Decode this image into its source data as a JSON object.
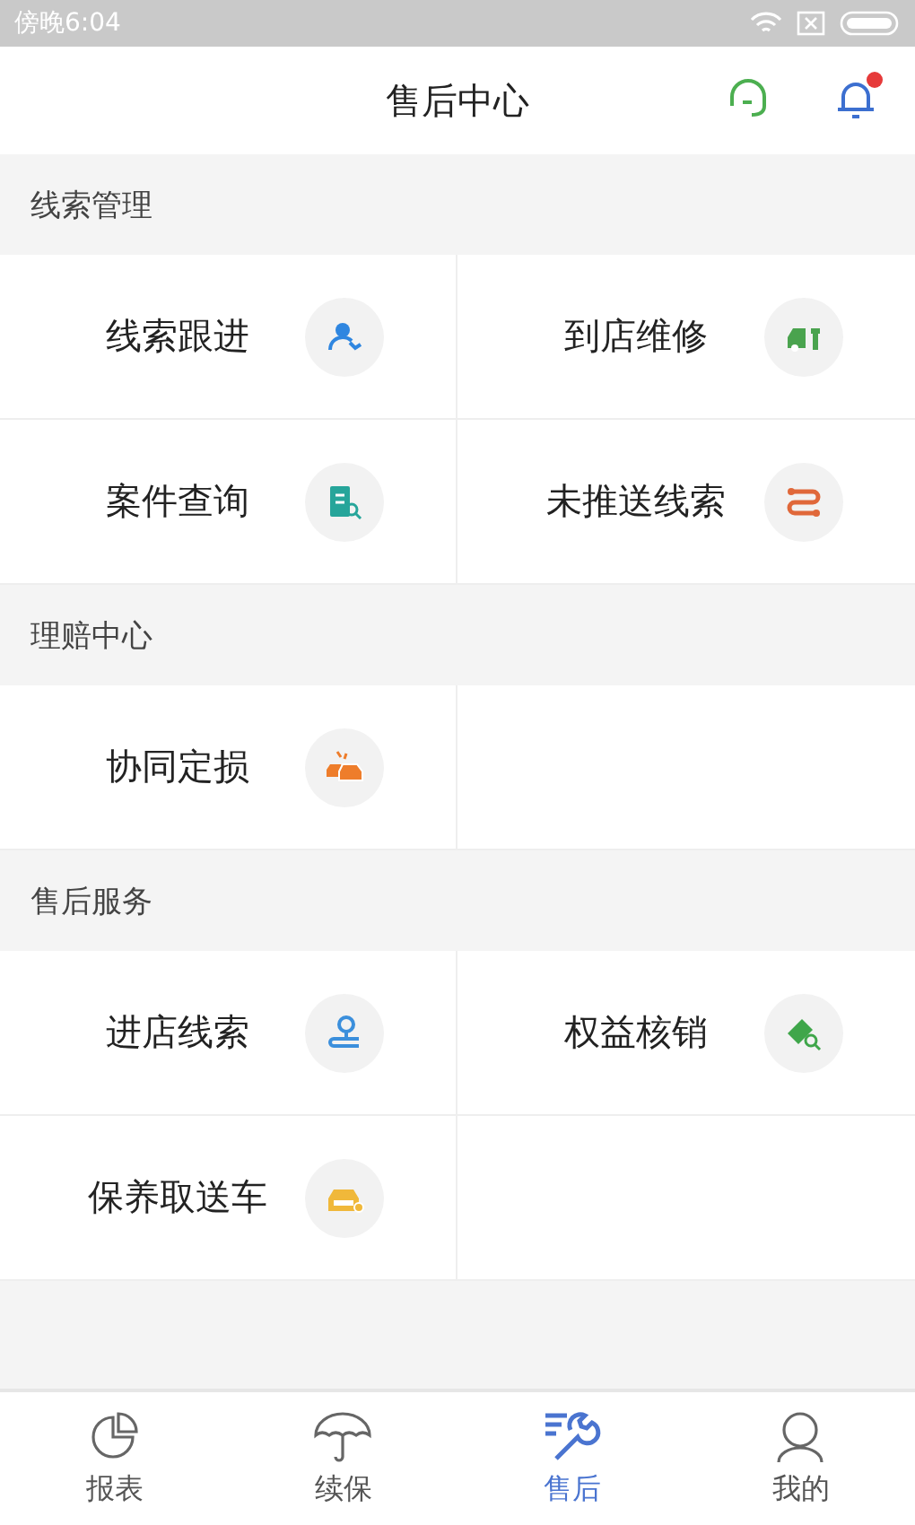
{
  "status_bar": {
    "time": "傍晚6:04"
  },
  "header": {
    "title": "售后中心",
    "bell_unread": true
  },
  "sections": [
    {
      "title": "线索管理",
      "items": [
        {
          "label": "线索跟进"
        },
        {
          "label": "到店维修"
        },
        {
          "label": "案件查询"
        },
        {
          "label": "未推送线索"
        }
      ]
    },
    {
      "title": "理赔中心",
      "items": [
        {
          "label": "协同定损"
        }
      ]
    },
    {
      "title": "售后服务",
      "items": [
        {
          "label": "进店线索"
        },
        {
          "label": "权益核销"
        },
        {
          "label": "保养取送车"
        }
      ]
    }
  ],
  "tab_bar": [
    {
      "label": "报表",
      "selected": false
    },
    {
      "label": "续保",
      "selected": false
    },
    {
      "label": "售后",
      "selected": true
    },
    {
      "label": "我的",
      "selected": false
    }
  ]
}
